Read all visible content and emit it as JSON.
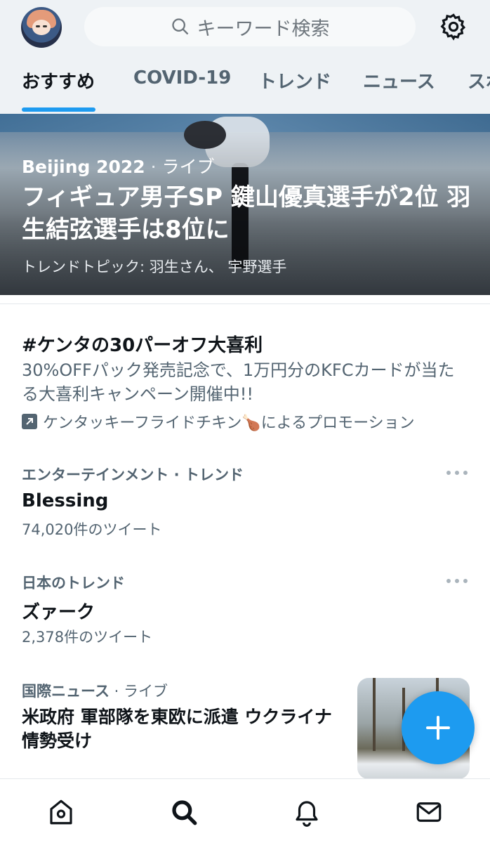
{
  "search": {
    "placeholder": "キーワード検索"
  },
  "tabs": [
    {
      "label": "おすすめ",
      "active": true
    },
    {
      "label": "COVID-19",
      "active": false
    },
    {
      "label": "トレンド",
      "active": false
    },
    {
      "label": "ニュース",
      "active": false
    },
    {
      "label": "スポ",
      "active": false
    }
  ],
  "hero": {
    "event": "Beijing 2022",
    "separator": "·",
    "status": "ライブ",
    "title": "フィギュア男子SP 鍵山優真選手が2位 羽生結弦選手は8位に",
    "topics": "トレンドトピック: 羽生さん、 宇野選手"
  },
  "promo": {
    "title": "#ケンタの30パーオフ大喜利",
    "description": "30%OFFパック発売記念で、1万円分のKFCカードが当たる大喜利キャンペーン開催中!!",
    "advertiser": "ケンタッキーフライドチキン🍗によるプロモーション"
  },
  "trends": [
    {
      "category": "エンターテインメント · トレンド",
      "name": "Blessing",
      "count": "74,020件のツイート"
    },
    {
      "category": "日本のトレンド",
      "name": "ズァーク",
      "count": "2,378件のツイート"
    }
  ],
  "news": {
    "category": "国際ニュース",
    "separator": "·",
    "status": "ライブ",
    "title": "米政府 軍部隊を東欧に派遣 ウクライナ情勢受け"
  },
  "colors": {
    "accent": "#1d9bf0",
    "secondary_text": "#536471",
    "header_bg": "#eef2f5"
  },
  "icons": {
    "nav": [
      "home-icon",
      "search-icon",
      "notifications-icon",
      "messages-icon"
    ],
    "fab": "compose-plus-icon",
    "settings": "gear-icon"
  }
}
